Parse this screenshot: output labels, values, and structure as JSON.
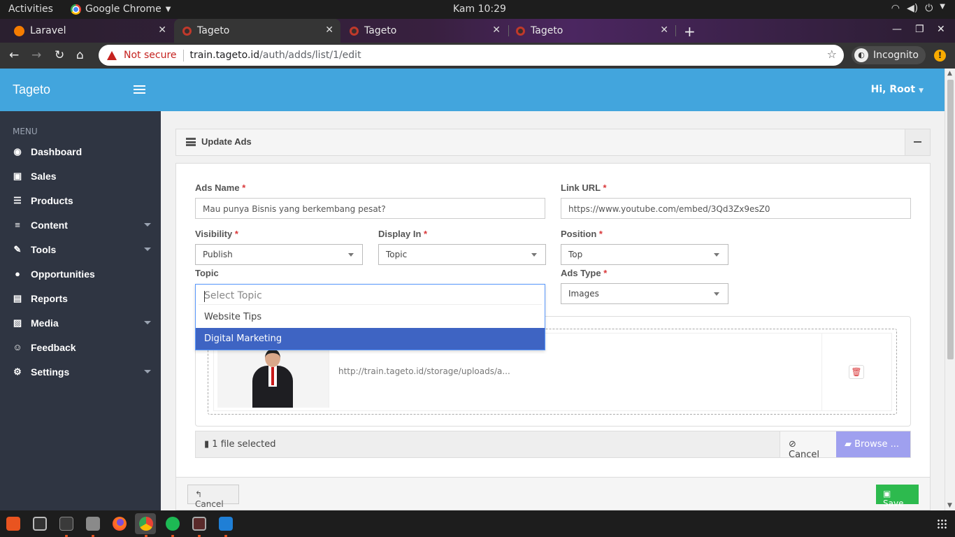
{
  "system": {
    "activities": "Activities",
    "app_menu": "Google Chrome",
    "clock": "Kam 10:29"
  },
  "browser": {
    "tabs": [
      {
        "label": "Laravel",
        "favicon_color": "#f57c00"
      },
      {
        "label": "Tageto",
        "favicon_color": "#c0392b"
      },
      {
        "label": "Tageto",
        "favicon_color": "#c0392b"
      },
      {
        "label": "Tageto",
        "favicon_color": "#c0392b"
      }
    ],
    "security_label": "Not secure",
    "url_host": "train.tageto.id",
    "url_path": "/auth/adds/list/1/edit",
    "incognito_label": "Incognito"
  },
  "app": {
    "brand": "Tageto",
    "greeting": "Hi, Root"
  },
  "sidebar": {
    "title": "MENU",
    "items": [
      {
        "label": "Dashboard",
        "icon": "dashboard-icon",
        "glyph": "◉"
      },
      {
        "label": "Sales",
        "icon": "money-icon",
        "glyph": "▣"
      },
      {
        "label": "Products",
        "icon": "list-icon",
        "glyph": "☰"
      },
      {
        "label": "Content",
        "icon": "lines-icon",
        "glyph": "≡"
      },
      {
        "label": "Tools",
        "icon": "wrench-icon",
        "glyph": "✎"
      },
      {
        "label": "Opportunities",
        "icon": "bomb-icon",
        "glyph": "●"
      },
      {
        "label": "Reports",
        "icon": "file-icon",
        "glyph": "▤"
      },
      {
        "label": "Media",
        "icon": "image-icon",
        "glyph": "▨"
      },
      {
        "label": "Feedback",
        "icon": "smile-icon",
        "glyph": "☺"
      },
      {
        "label": "Settings",
        "icon": "cogs-icon",
        "glyph": "⚙"
      }
    ]
  },
  "panel": {
    "title": "Update Ads"
  },
  "form": {
    "ads_name_label": "Ads Name",
    "ads_name_value": "Mau punya Bisnis yang berkembang pesat?",
    "link_url_label": "Link URL",
    "link_url_value": "https://www.youtube.com/embed/3Qd3Zx9esZ0",
    "visibility_label": "Visibility",
    "visibility_value": "Publish",
    "display_in_label": "Display In",
    "display_in_value": "Topic",
    "position_label": "Position",
    "position_value": "Top",
    "topic_label": "Topic",
    "ads_type_label": "Ads Type",
    "ads_type_value": "Images",
    "required_mark": "*"
  },
  "topic_dropdown": {
    "placeholder": "Select Topic",
    "options": [
      "Website Tips",
      "Digital Marketing"
    ],
    "highlighted": "Digital Marketing"
  },
  "upload": {
    "preview_url": "http://train.tageto.id/storage/uploads/a...",
    "file_count": "1 file selected",
    "cancel_label": "Cancel",
    "browse_label": "Browse ..."
  },
  "footer": {
    "cancel_label": "Cancel",
    "save_label": "Save"
  }
}
